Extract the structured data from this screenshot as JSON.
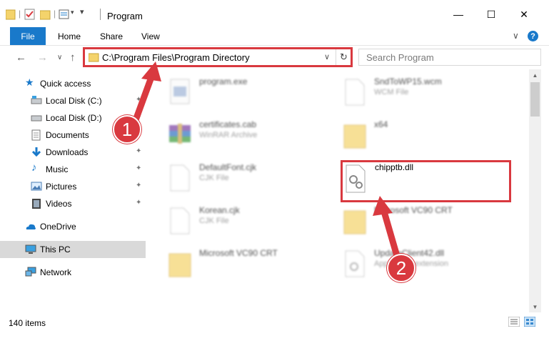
{
  "window": {
    "title": "Program",
    "minimize_glyph": "—",
    "maximize_glyph": "☐",
    "close_glyph": "✕"
  },
  "ribbon": {
    "tabs": [
      "File",
      "Home",
      "Share",
      "View"
    ],
    "help_glyph": "?",
    "expand_glyph": "∨"
  },
  "nav": {
    "back_glyph": "←",
    "forward_glyph": "→",
    "recent_glyph": "∨",
    "up_glyph": "↑",
    "address": "C:\\Program Files\\Program Directory",
    "address_chevron": "∨",
    "refresh_glyph": "↻",
    "search_placeholder": "Search Program",
    "search_glyph": "⚲"
  },
  "sidebar": {
    "items": [
      {
        "label": "Quick access",
        "icon": "star-icon"
      },
      {
        "label": "Local Disk (C:)",
        "icon": "drive-icon"
      },
      {
        "label": "Local Disk (D:)",
        "icon": "drive-icon"
      },
      {
        "label": "Documents",
        "icon": "documents-icon"
      },
      {
        "label": "Downloads",
        "icon": "downloads-icon"
      },
      {
        "label": "Music",
        "icon": "music-icon"
      },
      {
        "label": "Pictures",
        "icon": "pictures-icon"
      },
      {
        "label": "Videos",
        "icon": "videos-icon"
      },
      {
        "label": "OneDrive",
        "icon": "cloud-icon"
      },
      {
        "label": "This PC",
        "icon": "computer-icon"
      },
      {
        "label": "Network",
        "icon": "network-icon"
      }
    ],
    "pin_glyph": "📌"
  },
  "files": [
    {
      "name": "program.exe",
      "type": ""
    },
    {
      "name": "SndToWP15.wcm",
      "type": "WCM File"
    },
    {
      "name": "certificates.cab",
      "type": "WinRAR Archive"
    },
    {
      "name": "x64",
      "type": ""
    },
    {
      "name": "DefaultFont.cjk",
      "type": "CJK File"
    },
    {
      "name": "chipptb.dll",
      "type": ""
    },
    {
      "name": "Korean.cjk",
      "type": "CJK File"
    },
    {
      "name": "Microsoft VC90 CRT",
      "type": ""
    },
    {
      "name": "Microsoft VC90 CRT",
      "type": ""
    },
    {
      "name": "UpdateClient42.dll",
      "type": "Application extension"
    }
  ],
  "status": {
    "item_count": "140 items"
  },
  "annotations": {
    "step1": "1",
    "step2": "2",
    "color": "#d9393f"
  }
}
